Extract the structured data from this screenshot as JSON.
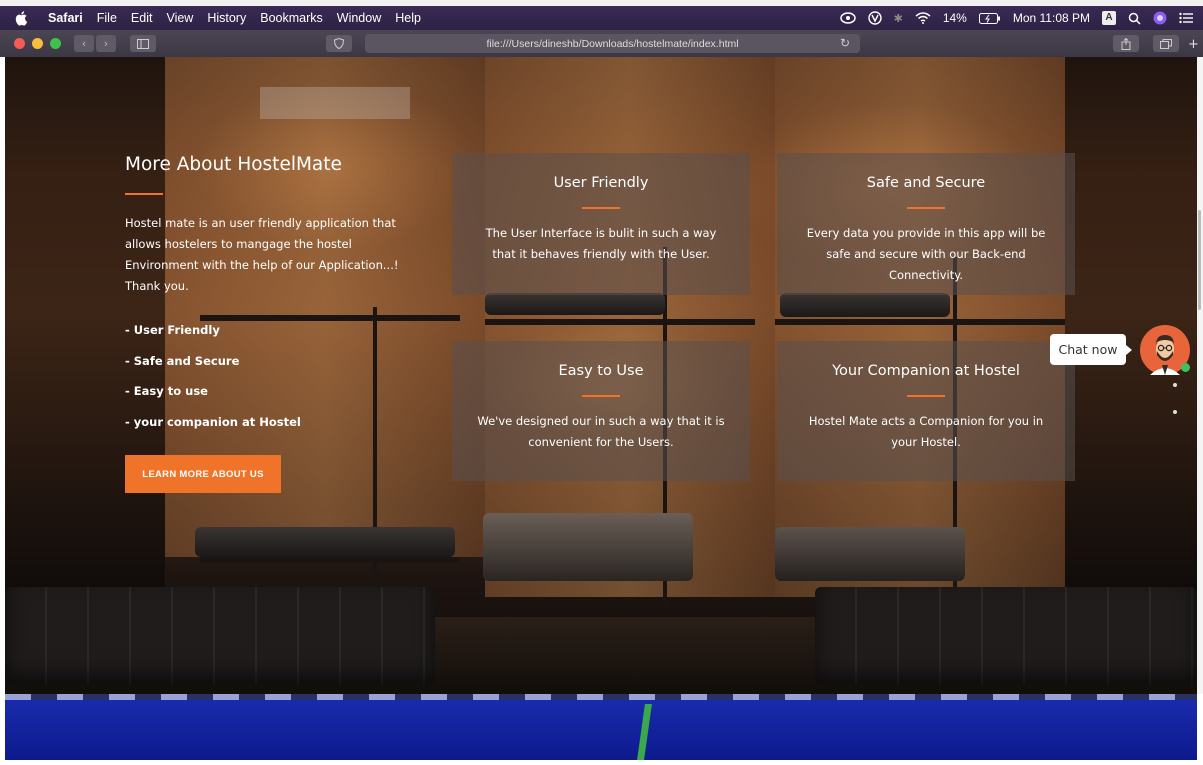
{
  "menubar": {
    "app": "Safari",
    "items": [
      "File",
      "Edit",
      "View",
      "History",
      "Bookmarks",
      "Window",
      "Help"
    ],
    "battery": "14%",
    "clock": "Mon 11:08 PM",
    "input_badge": "A"
  },
  "toolbar": {
    "url": "file:///Users/dineshb/Downloads/hostelmate/index.html"
  },
  "about": {
    "title": "More About HostelMate",
    "text": "Hostel mate is an user friendly application that allows hostelers to mangage the hostel Environment with the help of our Application...! Thank you.",
    "list": [
      "- User Friendly",
      "- Safe and Secure",
      "- Easy to use",
      "- your companion at Hostel"
    ],
    "button": "LEARN MORE ABOUT US"
  },
  "cards": [
    {
      "title": "User Friendly",
      "text": "The User Interface is bulit in such a way that it behaves friendly with the User."
    },
    {
      "title": "Safe and Secure",
      "text": "Every data you provide in this app will be safe and secure with our Back-end Connectivity."
    },
    {
      "title": "Easy to Use",
      "text": "We've designed our in such a way that it is convenient for the Users."
    },
    {
      "title": "Your Companion at Hostel",
      "text": "Hostel Mate acts a Companion for you in your Hostel."
    }
  ],
  "chat": {
    "label": "Chat now"
  },
  "colors": {
    "accent": "#f0732a",
    "menubar": "#2d2244",
    "band": "#1a2db0"
  }
}
